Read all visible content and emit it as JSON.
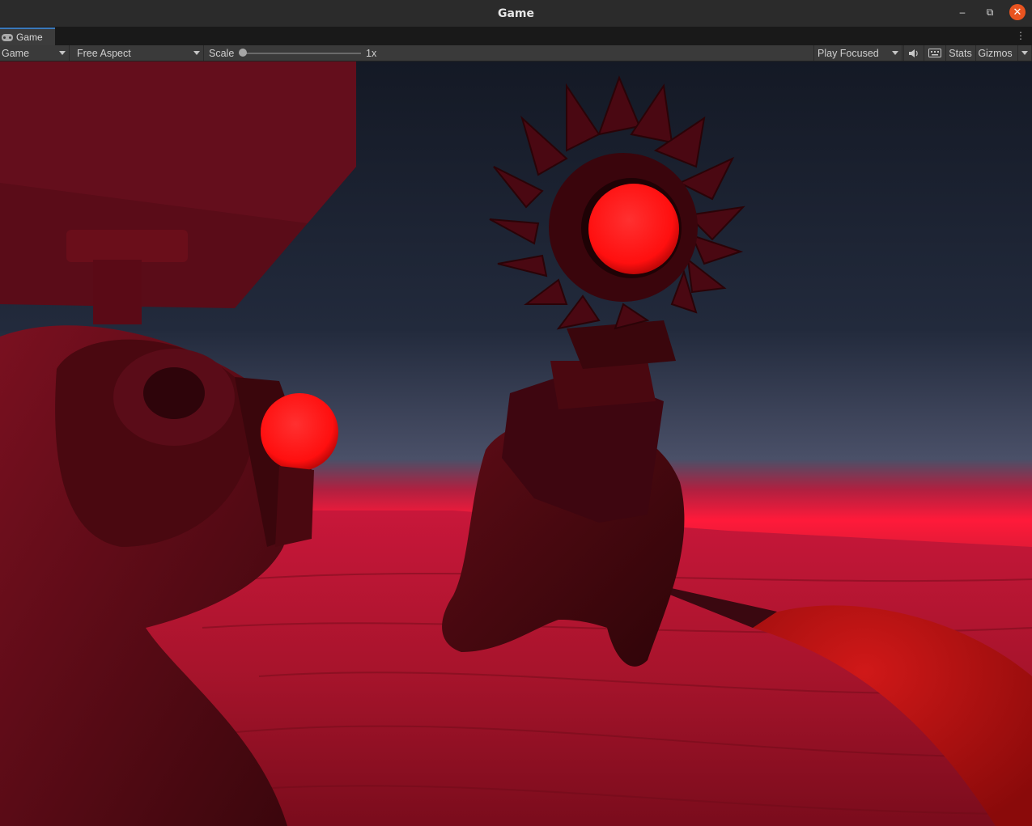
{
  "window": {
    "title": "Game"
  },
  "tab": {
    "label": "Game",
    "icon": "gamepad-icon"
  },
  "toolbar": {
    "display_select": "Game",
    "aspect_select": "Free Aspect",
    "scale_label": "Scale",
    "scale_value": "1x",
    "play_mode_select": "Play Focused",
    "stats_label": "Stats",
    "gizmos_label": "Gizmos"
  },
  "scene": {
    "sky_top": "#151a26",
    "sky_horizon": "#4a5068",
    "ground_glow": "#ff1a3a",
    "ground": "#b8162e",
    "orb_color": "#ff1a1a"
  },
  "colors": {
    "accent": "#3a79bb",
    "close": "#e95420"
  }
}
